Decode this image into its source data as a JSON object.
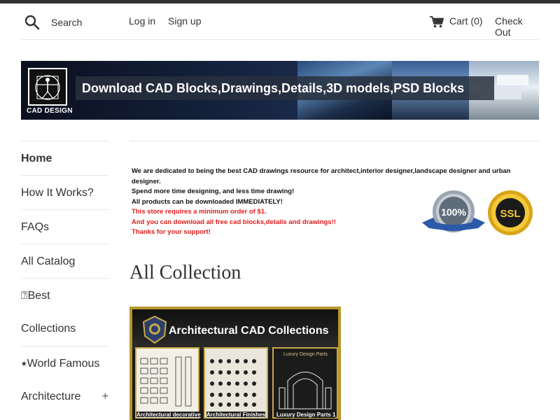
{
  "header": {
    "search_placeholder": "Search",
    "login_label": "Log in",
    "signup_label": "Sign up",
    "cart_label": "Cart (0)",
    "checkout_label": "Check Out"
  },
  "banner": {
    "logo_text": "CAD DESIGN",
    "headline": "Download CAD Blocks,Drawings,Details,3D models,PSD Blocks"
  },
  "sidebar": {
    "items": [
      {
        "label": "Home"
      },
      {
        "label": "How It Works?"
      },
      {
        "label": "FAQs"
      },
      {
        "label": "All Catalog"
      },
      {
        "label": "⍰Best",
        "sub": "Collections"
      },
      {
        "label": "⭑World Famous",
        "sub": "Architecture",
        "expand": "+"
      }
    ]
  },
  "intro": {
    "lines": [
      "We are dedicated to being the best CAD drawings resource for architect,interior designer,landscape designer and  urban designer.",
      "Spend more time designing, and less time drawing!",
      "All products can be downloaded IMMEDIATELY!"
    ],
    "red_lines": [
      "This store requires a minimum order of $1.",
      "And you can download all free cad blocks,details and drawings!!",
      "Thanks for your support!"
    ],
    "badge_100_text": "100%",
    "badge_ssl_text": "SSL"
  },
  "collection": {
    "title": "All Collection",
    "card_title": "Architectural CAD Collections",
    "panels": [
      {
        "caption": "Architectural decorative"
      },
      {
        "caption": "Architectural Finishes"
      },
      {
        "head": "Luxury Design Parts",
        "caption": "Luxury Design Parts 1"
      }
    ]
  },
  "colors": {
    "accent_red": "#e21a1a",
    "gold_border": "#b8962b",
    "banner_dark": "#13203a"
  }
}
